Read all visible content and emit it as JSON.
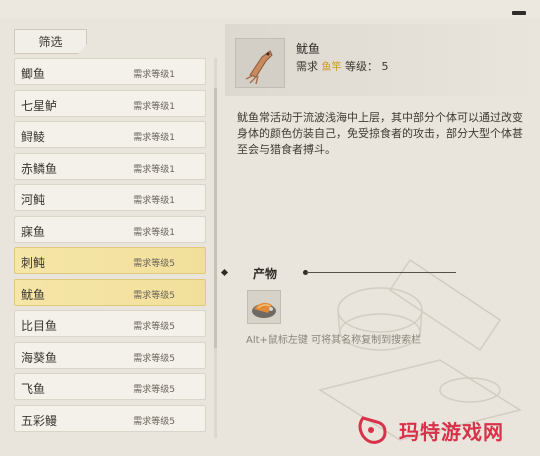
{
  "filter": {
    "label": "筛选"
  },
  "fish_list": [
    {
      "name": "鲫鱼",
      "level": "需求等级1",
      "highlighted": false
    },
    {
      "name": "七星鲈",
      "level": "需求等级1",
      "highlighted": false
    },
    {
      "name": "鲟鲮",
      "level": "需求等级1",
      "highlighted": false
    },
    {
      "name": "赤鳞鱼",
      "level": "需求等级1",
      "highlighted": false
    },
    {
      "name": "河鲀",
      "level": "需求等级1",
      "highlighted": false
    },
    {
      "name": "寐鱼",
      "level": "需求等级1",
      "highlighted": false
    },
    {
      "name": "刺鲀",
      "level": "需求等级5",
      "highlighted": true
    },
    {
      "name": "鱿鱼",
      "level": "需求等级5",
      "highlighted": true
    },
    {
      "name": "比目鱼",
      "level": "需求等级5",
      "highlighted": false
    },
    {
      "name": "海葵鱼",
      "level": "需求等级5",
      "highlighted": false
    },
    {
      "name": "飞鱼",
      "level": "需求等级5",
      "highlighted": false
    },
    {
      "name": "五彩鳗",
      "level": "需求等级5",
      "highlighted": false
    }
  ],
  "detail": {
    "name": "鱿鱼",
    "req_prefix": "需求",
    "req_tool": "鱼竿",
    "req_level_label": "等级：",
    "req_level": "5",
    "description": "鱿鱼常活动于流波浅海中上层，其中部分个体可以通过改变身体的颜色仿装自己，免受掠食者的攻击，部分大型个体甚至会与猎食者搏斗。"
  },
  "products": {
    "title": "产物",
    "hint": "Alt+鼠标左键 可将其名称复制到搜索栏"
  },
  "watermark": {
    "text": "玛特游戏网"
  },
  "colors": {
    "highlight": "#f6e6a7",
    "accent_gold": "#c99a1e",
    "watermark": "#d8324a"
  }
}
